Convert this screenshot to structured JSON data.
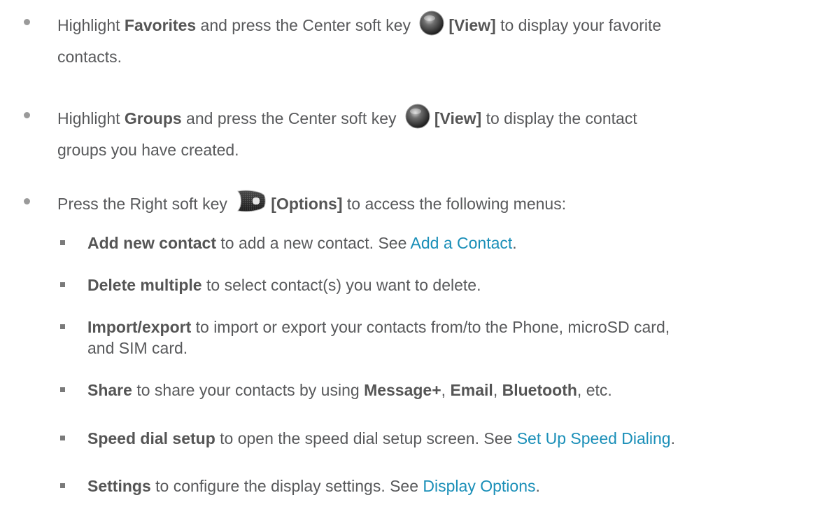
{
  "bullets": [
    {
      "line1": {
        "p1": "Highlight ",
        "b1": "Favorites",
        "p2": " and press the Center soft key ",
        "b2": "[View]",
        "p3": " to display your favorite"
      },
      "line2": "contacts."
    },
    {
      "line1": {
        "p1": "Highlight ",
        "b1": "Groups",
        "p2": " and press the Center soft key ",
        "b2": "[View]",
        "p3": " to display the contact"
      },
      "line2": "groups you have created."
    },
    {
      "line1": {
        "p1": "Press the Right soft key ",
        "b1": "[Options]",
        "p2": " to access the following menus:"
      }
    }
  ],
  "sub_items": [
    {
      "bold": "Add new contact",
      "text": " to add a new contact. See ",
      "link": "Add a Contact",
      "end": "."
    },
    {
      "bold": "Delete multiple",
      "text": " to select contact(s) you want to delete."
    },
    {
      "bold": "Import/export",
      "text": " to import or export your contacts from/to the Phone, microSD card,",
      "line2": "and SIM card."
    },
    {
      "bold": "Share",
      "text": " to share your contacts by using ",
      "b2": "Message+",
      "t2": ", ",
      "b3": "Email",
      "t3": ", ",
      "b4": "Bluetooth",
      "t4": ", etc."
    },
    {
      "bold": "Speed dial setup",
      "text": " to open the speed dial setup screen. See ",
      "link": "Set Up Speed Dialing",
      "end": "."
    },
    {
      "bold": "Settings",
      "text": " to configure the display settings. See ",
      "link": "Display Options",
      "end": "."
    }
  ],
  "icons": {
    "center_key": "center-soft-key-icon",
    "right_key": "right-soft-key-icon"
  },
  "colors": {
    "body_text": "#58595b",
    "link": "#1a8fb8"
  }
}
